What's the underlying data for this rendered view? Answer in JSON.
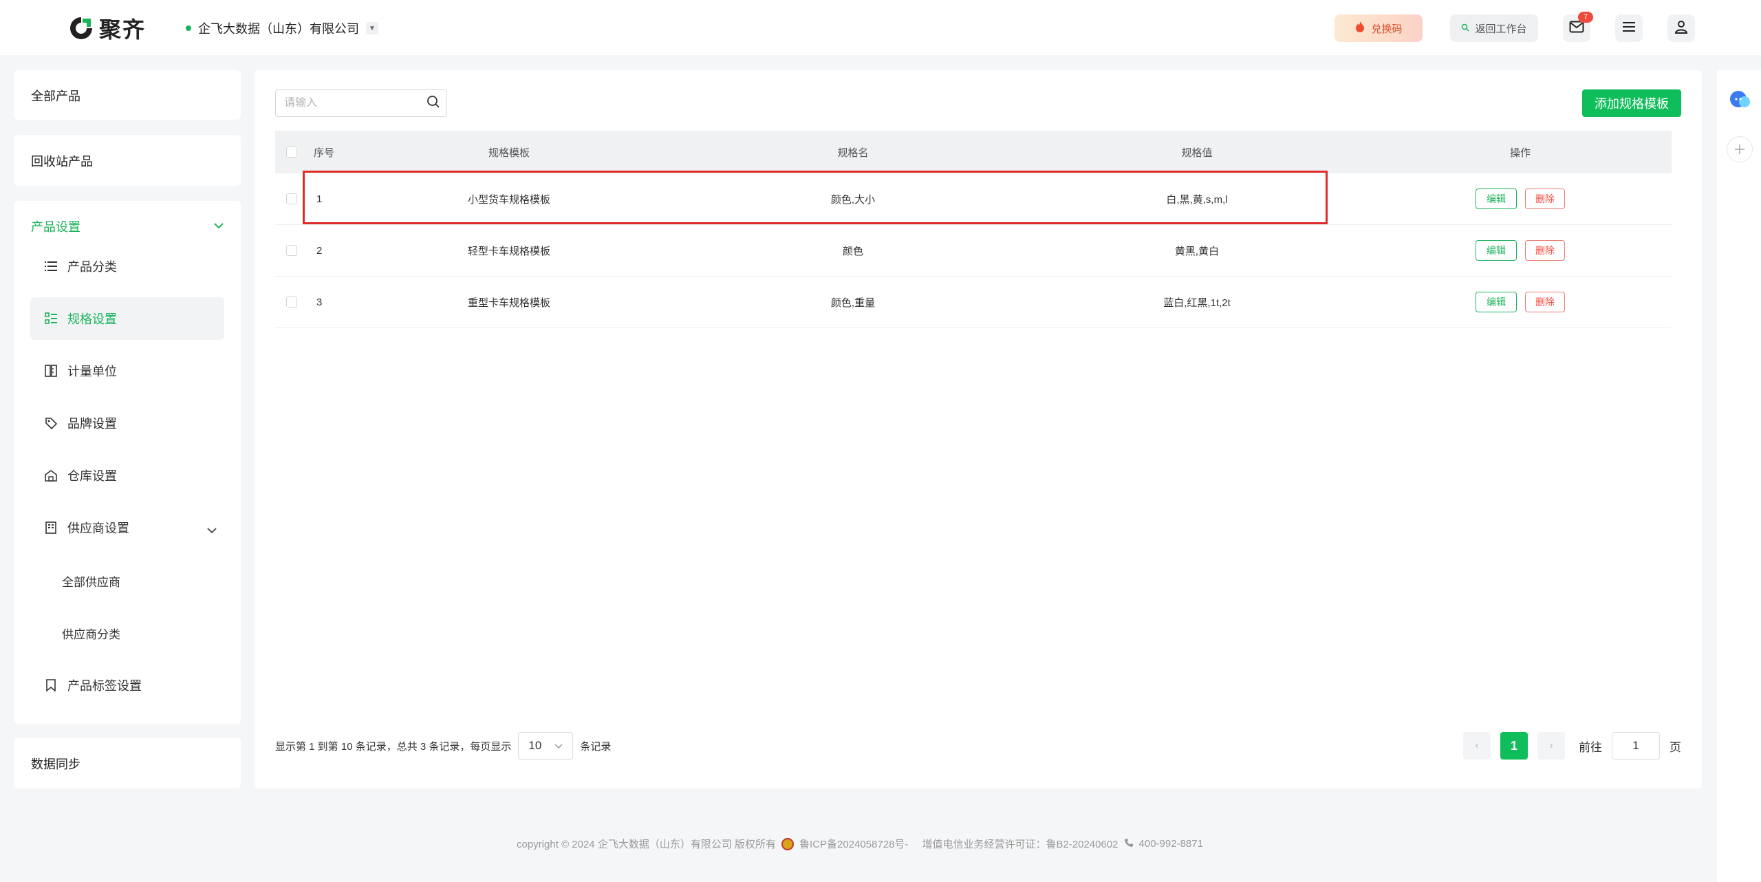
{
  "header": {
    "logo_text": "聚齐",
    "company": "企飞大数据（山东）有限公司",
    "coupon_label": "兑换码",
    "back_label": "返回工作台",
    "mail_badge": "7"
  },
  "sidebar": {
    "all_products": "全部产品",
    "recycle_products": "回收站产品",
    "product_settings": "产品设置",
    "items": [
      {
        "label": "产品分类"
      },
      {
        "label": "规格设置"
      },
      {
        "label": "计量单位"
      },
      {
        "label": "品牌设置"
      },
      {
        "label": "仓库设置"
      },
      {
        "label": "供应商设置"
      },
      {
        "label": "全部供应商"
      },
      {
        "label": "供应商分类"
      },
      {
        "label": "产品标签设置"
      }
    ],
    "data_sync": "数据同步"
  },
  "toolbar": {
    "search_placeholder": "请输入",
    "add_label": "添加规格模板"
  },
  "table": {
    "headers": {
      "index": "序号",
      "template": "规格模板",
      "name": "规格名",
      "value": "规格值",
      "ops": "操作"
    },
    "rows": [
      {
        "index": "1",
        "template": "小型货车规格模板",
        "name": "颜色,大小",
        "value": "白,黑,黄,s,m,l",
        "edit": "编辑",
        "delete": "删除"
      },
      {
        "index": "2",
        "template": "轻型卡车规格模板",
        "name": "颜色",
        "value": "黄黑,黄白",
        "edit": "编辑",
        "delete": "删除"
      },
      {
        "index": "3",
        "template": "重型卡车规格模板",
        "name": "颜色,重量",
        "value": "蓝白,红黑,1t,2t",
        "edit": "编辑",
        "delete": "删除"
      }
    ]
  },
  "pagination": {
    "summary": "显示第 1 到第 10 条记录，总共 3 条记录，每页显示",
    "page_size": "10",
    "suffix": "条记录",
    "current_page": "1",
    "goto_label": "前往",
    "goto_value": "1",
    "page_unit": "页"
  },
  "footer": {
    "copyright": "copyright © 2024 企飞大数据（山东）有限公司 版权所有",
    "icp": "鲁ICP备2024058728号-",
    "license": "增值电信业务经营许可证：鲁B2-20240602",
    "phone": "400-992-8871"
  },
  "colors": {
    "accent": "#0fbe5a",
    "danger": "#f04a3e",
    "highlight": "#e02a2a"
  }
}
